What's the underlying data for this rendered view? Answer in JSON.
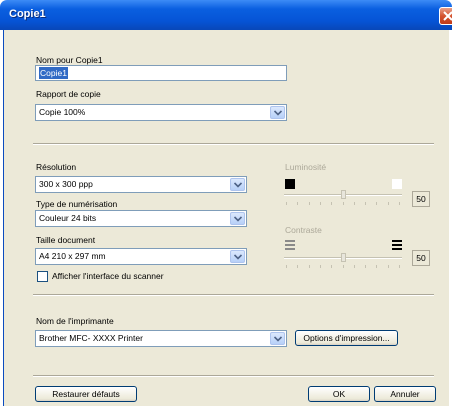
{
  "window": {
    "title": "Copie1"
  },
  "name_section": {
    "label": "Nom pour Copie1",
    "value": "Copie1"
  },
  "copy_ratio": {
    "label": "Rapport de copie",
    "value": "Copie 100%"
  },
  "resolution": {
    "label": "Résolution",
    "value": "300 x 300 ppp"
  },
  "scan_type": {
    "label": "Type de numérisation",
    "value": "Couleur 24 bits"
  },
  "doc_size": {
    "label": "Taille document",
    "value": "A4 210 x 297 mm"
  },
  "scanner_ui": {
    "label": "Afficher l'interface du scanner",
    "checked": false
  },
  "brightness": {
    "label": "Luminosité",
    "value": "50",
    "level": 0.5
  },
  "contrast": {
    "label": "Contraste",
    "value": "50",
    "level": 0.5
  },
  "printer": {
    "label": "Nom de l'imprimante",
    "value": "Brother MFC- XXXX Printer",
    "options_button": "Options d'impression..."
  },
  "footer": {
    "restore_button": "Restaurer défauts",
    "ok_button": "OK",
    "cancel_button": "Annuler"
  },
  "colors": {
    "titlebar": "#0654d6",
    "dialog_bg": "#ece9d8",
    "selection": "#316ac5",
    "disabled_text": "#aca899"
  }
}
